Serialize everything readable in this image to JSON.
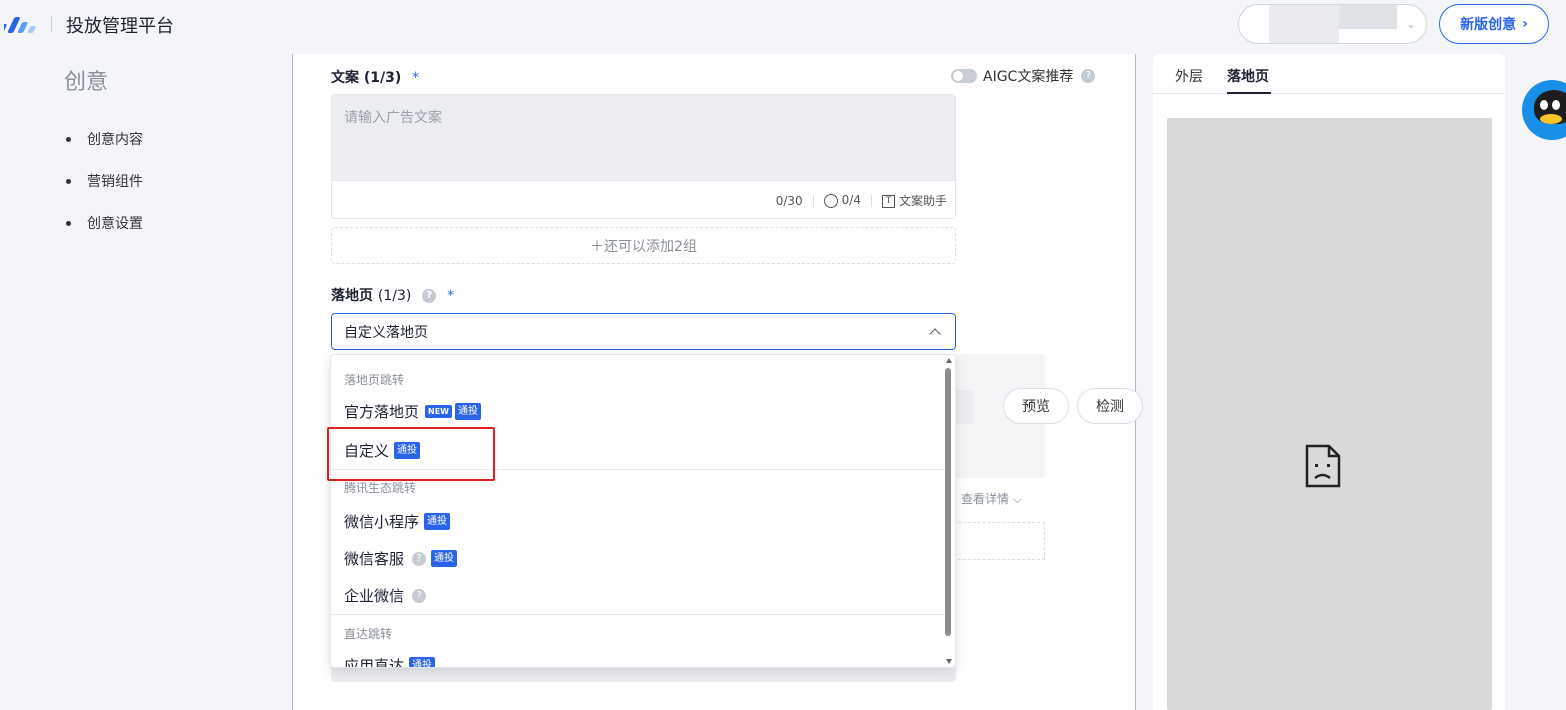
{
  "header": {
    "title": "投放管理平台",
    "new_creative_label": "新版创意"
  },
  "sidebar": {
    "title": "创意",
    "items": [
      {
        "label": "创意内容"
      },
      {
        "label": "营销组件"
      },
      {
        "label": "创意设置"
      }
    ]
  },
  "copy_section": {
    "label": "文案",
    "count": "(1/3)",
    "required_mark": "*",
    "aigc_label": "AIGC文案推荐",
    "placeholder": "请输入广告文案",
    "char_count": "0/30",
    "emoji_count": "0/4",
    "assistant_label": "文案助手",
    "add_group_label": "＋还可以添加2组"
  },
  "landing_section": {
    "label": "落地页",
    "count": "(1/3)",
    "required_mark": "*",
    "selected_value": "自定义落地页",
    "preview_label": "预览",
    "detect_label": "检测",
    "view_detail_label": "查看详情"
  },
  "dropdown": {
    "groups": [
      {
        "title": "落地页跳转",
        "items": [
          {
            "label": "官方落地页",
            "new_tag": "NEW",
            "tag": "通投"
          },
          {
            "label": "自定义",
            "tag": "通投"
          }
        ]
      },
      {
        "title": "腾讯生态跳转",
        "items": [
          {
            "label": "微信小程序",
            "tag": "通投"
          },
          {
            "label": "微信客服",
            "tag": "通投"
          },
          {
            "label": "企业微信"
          }
        ]
      },
      {
        "title": "直达跳转",
        "items": [
          {
            "label": "应用直达",
            "tag": "通投"
          }
        ]
      }
    ]
  },
  "preview_panel": {
    "tabs": [
      {
        "label": "外层",
        "active": false
      },
      {
        "label": "落地页",
        "active": true
      }
    ]
  },
  "colors": {
    "accent": "#2a64e8",
    "highlight": "#e02020"
  }
}
